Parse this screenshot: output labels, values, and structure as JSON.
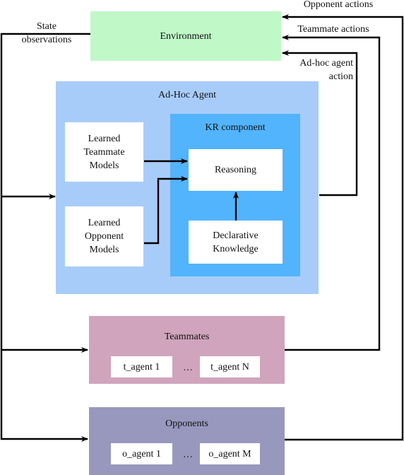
{
  "environment": {
    "label": "Environment",
    "color": "#c0f8c8"
  },
  "adhoc_agent": {
    "label": "Ad-Hoc Agent",
    "color": "#a8ccfa",
    "teammate_models": "Learned\nTeammate\nModels",
    "opponent_models": "Learned\nOpponent\nModels",
    "kr_component": {
      "label": "KR component",
      "color": "#52b4fc",
      "reasoning": "Reasoning",
      "declarative_knowledge": "Declarative\nKnowledge"
    }
  },
  "teammates": {
    "label": "Teammates",
    "color": "#d0a4bc",
    "first": "t_agent 1",
    "ellipsis": "…",
    "last": "t_agent N"
  },
  "opponents": {
    "label": "Opponents",
    "color": "#9898be",
    "first": "o_agent 1",
    "ellipsis": "…",
    "last": "o_agent M"
  },
  "edge_labels": {
    "state_observations": "State\nobservations",
    "opponent_actions": "Opponent actions",
    "teammate_actions": "Teammate actions",
    "adhoc_action": "Ad-hoc agent\naction"
  }
}
